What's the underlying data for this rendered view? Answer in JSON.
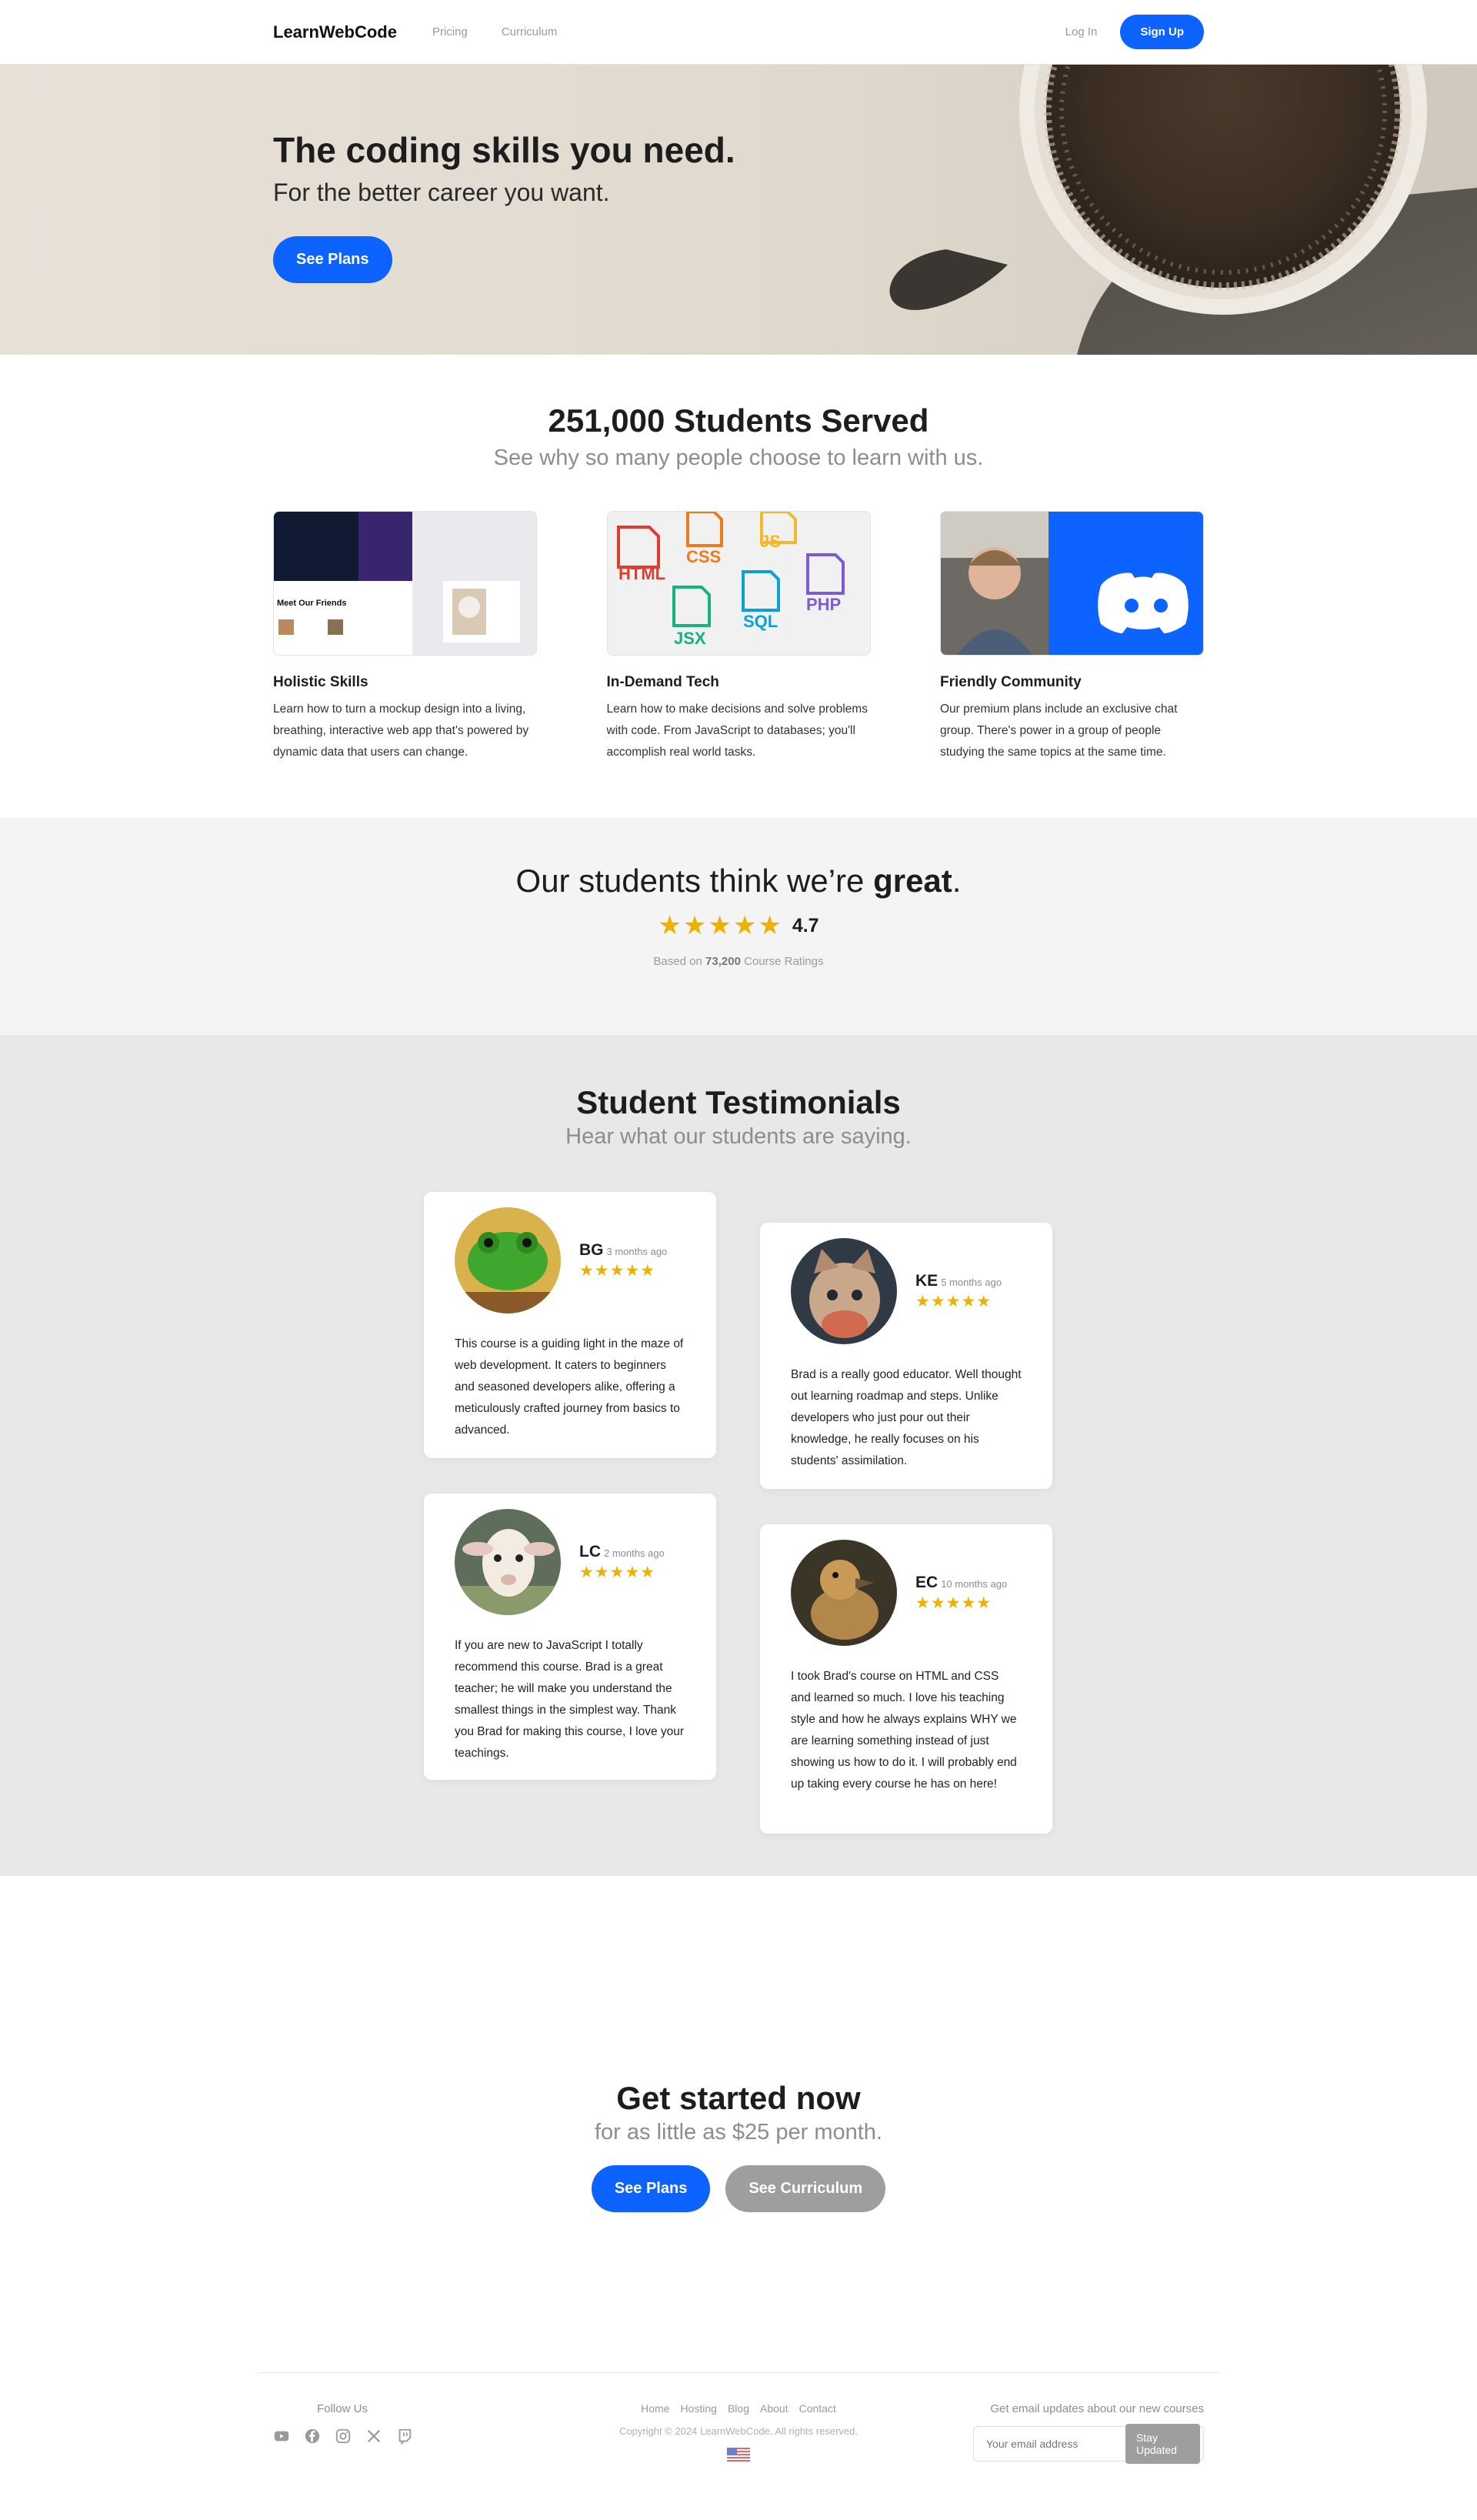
{
  "nav": {
    "brand": "LearnWebCode",
    "links": [
      "Pricing",
      "Curriculum"
    ],
    "login": "Log In",
    "signup": "Sign Up"
  },
  "hero": {
    "title": "The coding skills you need.",
    "subtitle": "For the better career you want.",
    "cta": "See Plans"
  },
  "served": {
    "title": "251,000 Students Served",
    "subtitle": "See why so many people choose to learn with us.",
    "features": [
      {
        "title": "Holistic Skills",
        "text": "Learn how to turn a mockup design into a living, breathing, interactive web app that's powered by dynamic data that users can change.",
        "mock_caption": "Meet Our Friends"
      },
      {
        "title": "In-Demand Tech",
        "text": "Learn how to make decisions and solve problems with code. From JavaScript to databases; you'll accomplish real world tasks.",
        "tags": [
          "HTML",
          "CSS",
          "JS",
          "JSX",
          "SQL",
          "PHP"
        ]
      },
      {
        "title": "Friendly Community",
        "text": "Our premium plans include an exclusive chat group. There's power in a group of people studying the same topics at the same time."
      }
    ]
  },
  "rating": {
    "headline_pre": "Our students think we’re ",
    "headline_bold": "great",
    "headline_post": ".",
    "stars": "★★★★★",
    "value": "4.7",
    "note_pre": "Based on ",
    "note_count": "73,200",
    "note_post": " Course Ratings"
  },
  "testimonials": {
    "title": "Student Testimonials",
    "subtitle": "Hear what our students are saying.",
    "items": [
      {
        "initials": "BG",
        "time": "3 months ago",
        "stars": "★★★★★",
        "avatar": "frog",
        "text": "This course is a guiding light in the maze of web development. It caters to beginners and seasoned developers alike, offering a meticulously crafted journey from basics to advanced."
      },
      {
        "initials": "KE",
        "time": "5 months ago",
        "stars": "★★★★★",
        "avatar": "cat",
        "text": "Brad is a really good educator. Well thought out learning roadmap and steps. Unlike developers who just pour out their knowledge, he really focuses on his students' assimilation."
      },
      {
        "initials": "LC",
        "time": "2 months ago",
        "stars": "★★★★★",
        "avatar": "lamb",
        "text": "If you are new to JavaScript I totally recommend this course. Brad is a great teacher; he will make you understand the smallest things in the simplest way. Thank you Brad for making this course, I love your teachings."
      },
      {
        "initials": "EC",
        "time": "10 months ago",
        "stars": "★★★★★",
        "avatar": "duckling",
        "text": "I took Brad's course on HTML and CSS and learned so much. I love his teaching style and how he always explains WHY we are learning something instead of just showing us how to do it. I will probably end up taking every course he has on here!"
      }
    ]
  },
  "cta": {
    "title": "Get started now",
    "subtitle": "for as little as $25 per month.",
    "primary": "See Plans",
    "secondary": "See Curriculum"
  },
  "footer": {
    "follow_label": "Follow Us",
    "socials": [
      "youtube-icon",
      "facebook-icon",
      "instagram-icon",
      "x-icon",
      "twitch-icon"
    ],
    "links": [
      "Home",
      "Hosting",
      "Blog",
      "About",
      "Contact"
    ],
    "copyright": "Copyright © 2024 LearnWebCode. All rights reserved.",
    "newsletter_label": "Get email updates about our new courses",
    "email_placeholder": "Your email address",
    "subscribe": "Stay Updated"
  },
  "colors": {
    "accent": "#0c63ff",
    "star": "#f0b000",
    "secondary_button": "#9e9e9e",
    "rating_bg": "#f4f4f4",
    "testimonials_bg": "#e8e8e8"
  }
}
